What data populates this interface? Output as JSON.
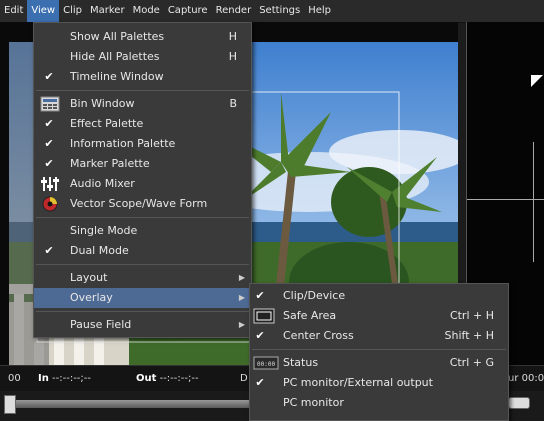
{
  "menubar": {
    "items": [
      "Edit",
      "View",
      "Clip",
      "Marker",
      "Mode",
      "Capture",
      "Render",
      "Settings",
      "Help"
    ],
    "active_index": 1
  },
  "view_menu": {
    "items": [
      {
        "label": "Show All Palettes",
        "shortcut": "H",
        "checked": false,
        "icon": ""
      },
      {
        "label": "Hide All Palettes",
        "shortcut": "H",
        "checked": false,
        "icon": ""
      },
      {
        "label": "Timeline Window",
        "shortcut": "",
        "checked": true,
        "icon": ""
      },
      {
        "label": "Bin Window",
        "shortcut": "B",
        "checked": false,
        "icon": "bin-window-icon"
      },
      {
        "label": "Effect Palette",
        "shortcut": "",
        "checked": true,
        "icon": ""
      },
      {
        "label": "Information  Palette",
        "shortcut": "",
        "checked": true,
        "icon": ""
      },
      {
        "label": "Marker Palette",
        "shortcut": "",
        "checked": true,
        "icon": ""
      },
      {
        "label": "Audio Mixer",
        "shortcut": "",
        "checked": false,
        "icon": "audio-mixer-icon"
      },
      {
        "label": "Vector Scope/Wave Form",
        "shortcut": "",
        "checked": false,
        "icon": "vector-scope-icon"
      },
      {
        "label": "Single Mode",
        "shortcut": "",
        "checked": false,
        "icon": ""
      },
      {
        "label": "Dual Mode",
        "shortcut": "",
        "checked": true,
        "icon": ""
      },
      {
        "label": "Layout",
        "shortcut": "",
        "checked": false,
        "icon": "",
        "submenu": true
      },
      {
        "label": "Overlay",
        "shortcut": "",
        "checked": false,
        "icon": "",
        "submenu": true,
        "highlighted": true
      },
      {
        "label": "Pause Field",
        "shortcut": "",
        "checked": false,
        "icon": "",
        "submenu": true
      }
    ]
  },
  "overlay_menu": {
    "items": [
      {
        "label": "Clip/Device",
        "shortcut": "",
        "checked": true,
        "icon": ""
      },
      {
        "label": "Safe Area",
        "shortcut": "Ctrl + H",
        "checked": false,
        "icon": "safe-area-icon"
      },
      {
        "label": "Center Cross",
        "shortcut": "Shift + H",
        "checked": true,
        "icon": ""
      },
      {
        "label": "Status",
        "shortcut": "Ctrl + G",
        "checked": false,
        "icon": "status-icon"
      },
      {
        "label": "PC monitor/External output",
        "shortcut": "",
        "checked": true,
        "icon": ""
      },
      {
        "label": "PC monitor",
        "shortcut": "",
        "checked": false,
        "icon": ""
      }
    ]
  },
  "timecode": {
    "left_value": "00",
    "in_label": "In",
    "in_value": "--:--:--;--",
    "out_label": "Out",
    "out_value": "--:--:--;--",
    "d_label": "D",
    "right_value": "ur 00:0"
  },
  "colors": {
    "menubar_active": "#3b6fb0",
    "menu_highlight": "#4d6a95",
    "menu_bg": "#3a3a3a"
  }
}
